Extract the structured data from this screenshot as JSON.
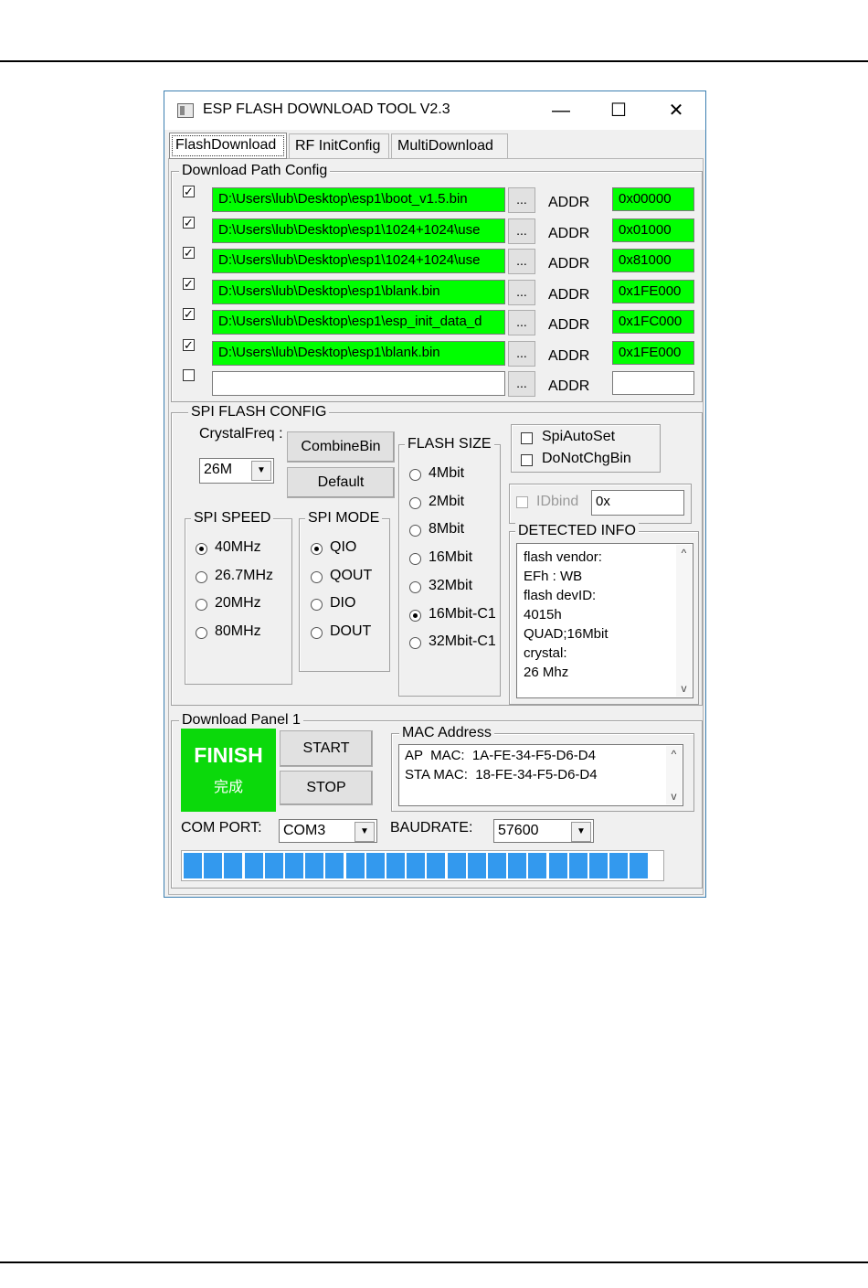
{
  "window": {
    "title": "ESP FLASH DOWNLOAD TOOL V2.3",
    "minimize": "—",
    "maximize": "☐",
    "close": "✕"
  },
  "tabs": [
    "FlashDownload",
    "RF InitConfig",
    "MultiDownload"
  ],
  "download_path": {
    "title": "Download Path Config",
    "browse_label": "...",
    "addr_label": "ADDR",
    "rows": [
      {
        "checked": true,
        "path": "D:\\Users\\lub\\Desktop\\esp1\\boot_v1.5.bin",
        "addr": "0x00000"
      },
      {
        "checked": true,
        "path": "D:\\Users\\lub\\Desktop\\esp1\\1024+1024\\use",
        "addr": "0x01000"
      },
      {
        "checked": true,
        "path": "D:\\Users\\lub\\Desktop\\esp1\\1024+1024\\use",
        "addr": "0x81000"
      },
      {
        "checked": true,
        "path": "D:\\Users\\lub\\Desktop\\esp1\\blank.bin",
        "addr": "0x1FE000"
      },
      {
        "checked": true,
        "path": "D:\\Users\\lub\\Desktop\\esp1\\esp_init_data_d",
        "addr": "0x1FC000"
      },
      {
        "checked": true,
        "path": "D:\\Users\\lub\\Desktop\\esp1\\blank.bin",
        "addr": "0x1FE000"
      },
      {
        "checked": false,
        "path": "",
        "addr": ""
      }
    ]
  },
  "spi": {
    "title": "SPI FLASH CONFIG",
    "crystal_label": "CrystalFreq :",
    "crystal_value": "26M",
    "combine_button": "CombineBin",
    "default_button": "Default",
    "speed": {
      "title": "SPI SPEED",
      "options": [
        "40MHz",
        "26.7MHz",
        "20MHz",
        "80MHz"
      ],
      "selected": "40MHz"
    },
    "mode": {
      "title": "SPI MODE",
      "options": [
        "QIO",
        "QOUT",
        "DIO",
        "DOUT"
      ],
      "selected": "QIO"
    },
    "flash_size": {
      "title": "FLASH SIZE",
      "options": [
        "4Mbit",
        "2Mbit",
        "8Mbit",
        "16Mbit",
        "32Mbit",
        "16Mbit-C1",
        "32Mbit-C1"
      ],
      "selected": "16Mbit-C1"
    },
    "spi_auto_set": "SpiAutoSet",
    "do_not_chg_bin": "DoNotChgBin",
    "idbind_label": "IDbind",
    "idbind_value": "0x",
    "detected": {
      "title": "DETECTED INFO",
      "lines": [
        "flash vendor:",
        "EFh : WB",
        "flash devID:",
        "4015h",
        "QUAD;16Mbit",
        "crystal:",
        "26 Mhz"
      ]
    }
  },
  "panel": {
    "title": "Download Panel 1",
    "status": "FINISH",
    "status_cn": "完成",
    "start": "START",
    "stop": "STOP",
    "mac_title": "MAC Address",
    "mac_lines": [
      "AP  MAC:  1A-FE-34-F5-D6-D4",
      "STA MAC:  18-FE-34-F5-D6-D4"
    ],
    "com_label": "COM PORT:",
    "com_value": "COM3",
    "baud_label": "BAUDRATE:",
    "baud_value": "57600",
    "progress": 1.0
  },
  "colors": {
    "ok_green": "#00ff00",
    "finish_green": "#0bd90b",
    "progress_blue": "#3399ee"
  }
}
